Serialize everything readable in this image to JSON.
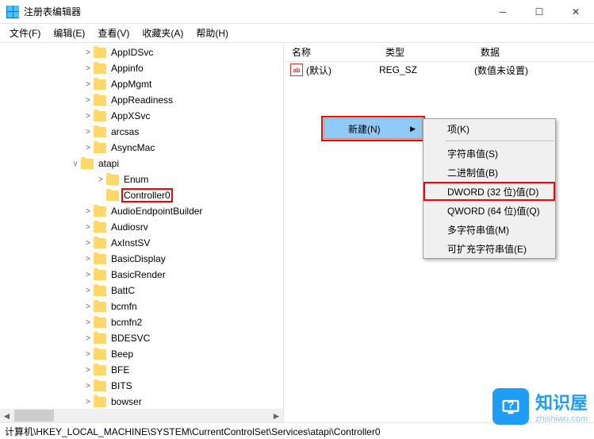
{
  "window": {
    "title": "注册表编辑器"
  },
  "menu": {
    "file": "文件(F)",
    "edit": "编辑(E)",
    "view": "查看(V)",
    "fav": "收藏夹(A)",
    "help": "帮助(H)"
  },
  "tree": [
    {
      "indent": 100,
      "exp": ">",
      "label": "AppIDSvc"
    },
    {
      "indent": 100,
      "exp": ">",
      "label": "Appinfo"
    },
    {
      "indent": 100,
      "exp": ">",
      "label": "AppMgmt"
    },
    {
      "indent": 100,
      "exp": ">",
      "label": "AppReadiness"
    },
    {
      "indent": 100,
      "exp": ">",
      "label": "AppXSvc"
    },
    {
      "indent": 100,
      "exp": ">",
      "label": "arcsas"
    },
    {
      "indent": 100,
      "exp": ">",
      "label": "AsyncMac"
    },
    {
      "indent": 84,
      "exp": "v",
      "label": "atapi"
    },
    {
      "indent": 116,
      "exp": ">",
      "label": "Enum"
    },
    {
      "indent": 116,
      "exp": "",
      "label": "Controller0",
      "hl": true
    },
    {
      "indent": 100,
      "exp": ">",
      "label": "AudioEndpointBuilder"
    },
    {
      "indent": 100,
      "exp": ">",
      "label": "Audiosrv"
    },
    {
      "indent": 100,
      "exp": ">",
      "label": "AxInstSV"
    },
    {
      "indent": 100,
      "exp": ">",
      "label": "BasicDisplay"
    },
    {
      "indent": 100,
      "exp": ">",
      "label": "BasicRender"
    },
    {
      "indent": 100,
      "exp": ">",
      "label": "BattC"
    },
    {
      "indent": 100,
      "exp": ">",
      "label": "bcmfn"
    },
    {
      "indent": 100,
      "exp": ">",
      "label": "bcmfn2"
    },
    {
      "indent": 100,
      "exp": ">",
      "label": "BDESVC"
    },
    {
      "indent": 100,
      "exp": ">",
      "label": "Beep"
    },
    {
      "indent": 100,
      "exp": ">",
      "label": "BFE"
    },
    {
      "indent": 100,
      "exp": ">",
      "label": "BITS"
    },
    {
      "indent": 100,
      "exp": ">",
      "label": "bowser"
    }
  ],
  "columns": {
    "name": "名称",
    "type": "类型",
    "data": "数据"
  },
  "values": [
    {
      "name": "(默认)",
      "type": "REG_SZ",
      "data": "(数值未设置)"
    }
  ],
  "ctx1": {
    "new": "新建(N)"
  },
  "ctx2": {
    "key": "项(K)",
    "string": "字符串值(S)",
    "binary": "二进制值(B)",
    "dword": "DWORD (32 位)值(D)",
    "qword": "QWORD (64 位)值(Q)",
    "multi": "多字符串值(M)",
    "expand": "可扩充字符串值(E)"
  },
  "status": "计算机\\HKEY_LOCAL_MACHINE\\SYSTEM\\CurrentControlSet\\Services\\atapi\\Controller0",
  "watermark": {
    "title": "知识屋",
    "sub": "zhishiwu.com"
  }
}
